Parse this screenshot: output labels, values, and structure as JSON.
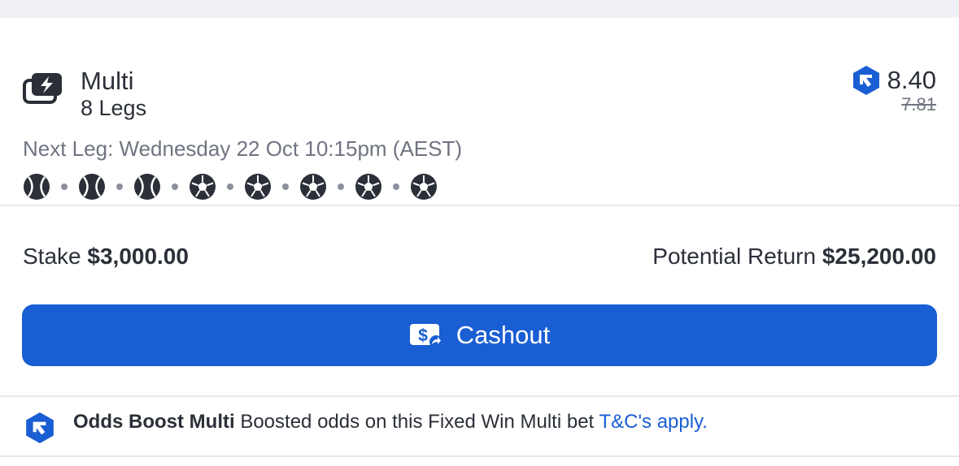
{
  "bet": {
    "title": "Multi",
    "legs_label": "8 Legs",
    "next_leg": "Next Leg: Wednesday 22 Oct 10:15pm (AEST)",
    "odds": "8.40",
    "original_odds": "7.81",
    "legs": [
      {
        "sport": "tennis",
        "icon": "tennis-ball-icon"
      },
      {
        "sport": "tennis",
        "icon": "tennis-ball-icon"
      },
      {
        "sport": "tennis",
        "icon": "tennis-ball-icon"
      },
      {
        "sport": "soccer",
        "icon": "soccer-ball-icon"
      },
      {
        "sport": "soccer",
        "icon": "soccer-ball-icon"
      },
      {
        "sport": "soccer",
        "icon": "soccer-ball-icon"
      },
      {
        "sport": "soccer",
        "icon": "soccer-ball-icon"
      },
      {
        "sport": "soccer",
        "icon": "soccer-ball-icon"
      }
    ]
  },
  "stake": {
    "label": "Stake",
    "amount": "$3,000.00",
    "return_label": "Potential Return",
    "return_amount": "$25,200.00"
  },
  "cashout": {
    "label": "Cashout",
    "icon": "cashout-icon"
  },
  "promo": {
    "title": "Odds Boost Multi",
    "text": "Boosted odds on this Fixed Win Multi bet",
    "link": "T&C's apply.",
    "icon": "odds-boost-icon"
  },
  "colors": {
    "accent": "#1a5ed3",
    "text": "#2b2f38",
    "muted": "#6f7481",
    "divider": "#e7e8ec",
    "background_band": "#f0f1f4"
  }
}
